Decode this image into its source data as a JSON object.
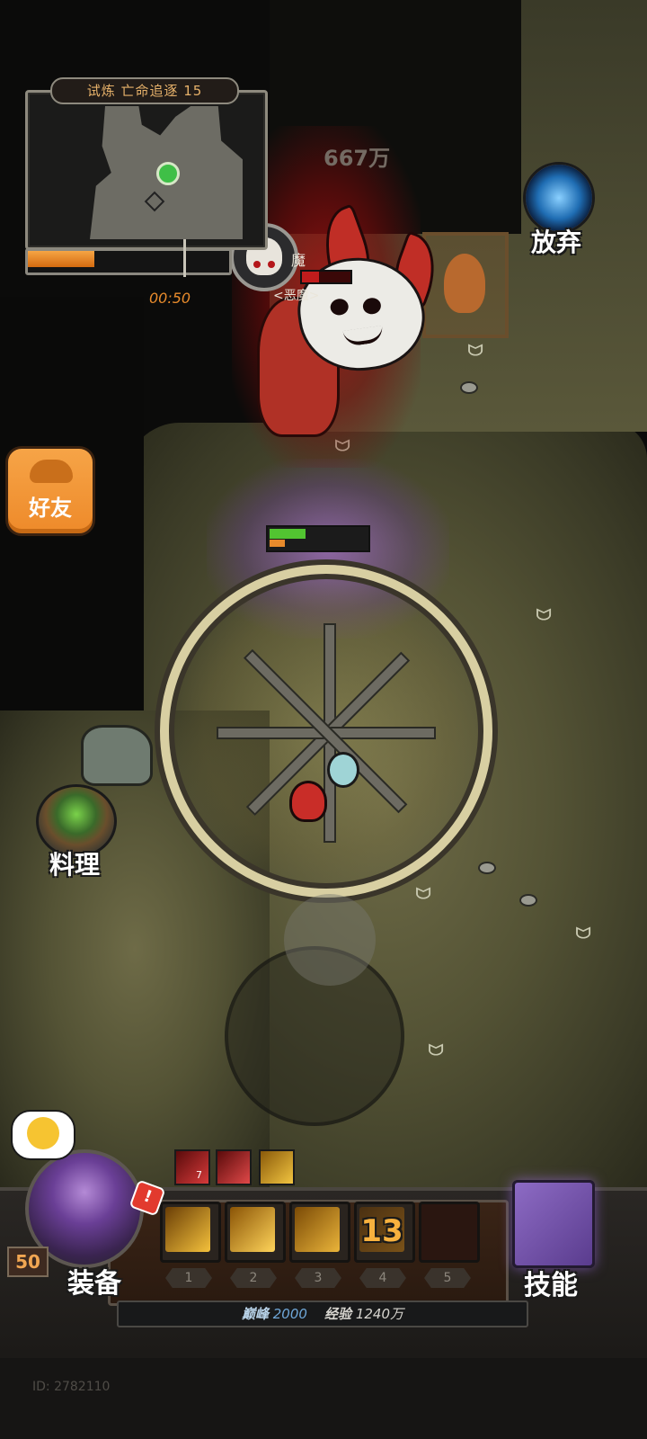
{
  "stage": {
    "title": "试炼 亡命追逐 15",
    "progress_fraction": 0.34,
    "timer": "00:50"
  },
  "boss": {
    "name_partial": "魔",
    "subtitle": "<恶魔>",
    "floating_damage": "667万",
    "hp_fraction": 0.35
  },
  "player": {
    "hp_fraction": 0.38,
    "level": "50"
  },
  "buttons": {
    "abandon": "放弃",
    "friends": "好友",
    "cooking": "料理",
    "equipment": "装备",
    "skills": "技能",
    "alert": "!"
  },
  "buffs": [
    {
      "icon": "blood-slash-icon",
      "count": "7"
    },
    {
      "icon": "blood-blade-icon"
    },
    {
      "icon": "golden-slash-icon"
    }
  ],
  "skill_slots": [
    {
      "number": "1",
      "icon": "golden-wave-icon"
    },
    {
      "number": "2",
      "icon": "golden-slash-icon"
    },
    {
      "number": "3",
      "icon": "golden-claw-icon"
    },
    {
      "number": "4",
      "cooldown": "13"
    },
    {
      "number": "5",
      "empty": true
    }
  ],
  "experience": {
    "peak_label": "巅峰",
    "peak_value": "2000",
    "exp_label": "经验",
    "exp_value": "1240万"
  },
  "footer": {
    "user_id": "ID: 2782110"
  },
  "colors": {
    "accent_orange": "#e88b2c",
    "hp_green": "#52c431",
    "boss_red": "#b03126"
  }
}
